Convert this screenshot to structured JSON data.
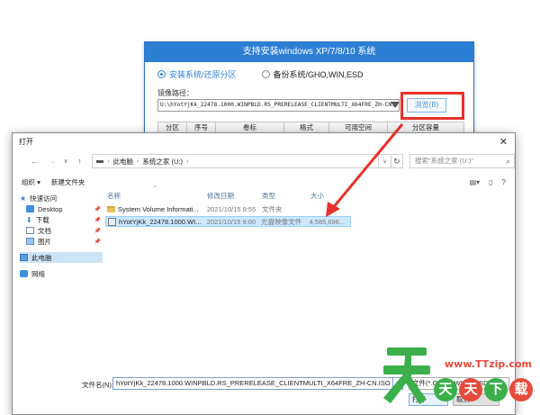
{
  "installer": {
    "title": "支持安装windows XP/7/8/10 系统",
    "mode_install": "安装系统/还原分区",
    "mode_backup": "备份系统/GHO,WIN,ESD",
    "path_label": "镜像路径：",
    "path_value": "U:\\hYotYjKk_22478.1000.WINPBLD.RS_PRERELEASE_CLIENTMULTI_X64FRE_ZH-CN.ISO",
    "browse_label": "浏览(B)",
    "columns": [
      "分区",
      "序号",
      "卷标",
      "格式",
      "可用空间",
      "分区容量"
    ]
  },
  "dialog": {
    "title": "打开",
    "breadcrumb": [
      "此电脑",
      "系统之家 (U:)"
    ],
    "search_placeholder": "搜索\"系统之家 (U:)\"",
    "toolbar_organize": "组织 ▾",
    "toolbar_new_folder": "新建文件夹",
    "nav": {
      "quick_access": "快速访问",
      "desktop": "Desktop",
      "downloads": "下载",
      "documents": "文档",
      "pictures": "图片",
      "this_pc": "此电脑",
      "network": "网络"
    },
    "columns": {
      "name": "名称",
      "date": "修改日期",
      "type": "类型",
      "size": "大小"
    },
    "files": [
      {
        "name": "System Volume Informati...",
        "date": "2021/10/15 9:55",
        "type": "文件夹",
        "size": ""
      },
      {
        "name": "hYotYjKk_22478.1000.WI...",
        "date": "2021/10/15 9:00",
        "type": "光盘映像文件",
        "size": "4,585,696..."
      }
    ],
    "filename_label": "文件名(N):",
    "filename_value": "hYotYjKk_22478.1000.WINPBLD.RS_PRERELEASE_CLIENTMULTI_X64FRE_ZH-CN.ISO",
    "filetype_value": "文件(*.GHO;*.WIM;*.ESD",
    "open_label": "打开",
    "cancel_label": "取消"
  },
  "watermark": {
    "url": "www.TTzip.com",
    "chars": [
      "天",
      "天",
      "下",
      "载"
    ]
  },
  "colors": {
    "accent": "#2d7fd5",
    "highlight": "#e8302a",
    "watermark_green": "#3bb04a"
  }
}
